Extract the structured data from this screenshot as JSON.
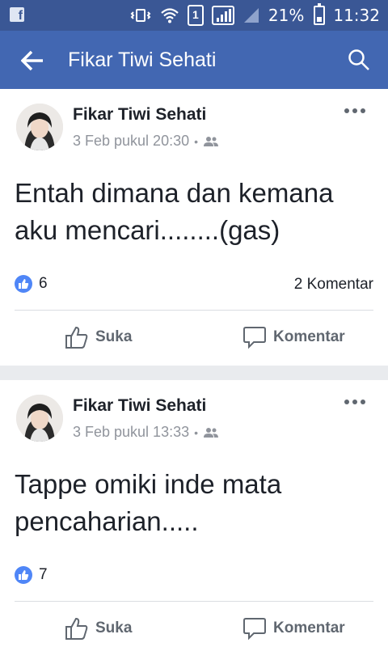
{
  "status_bar": {
    "battery_percent": "21%",
    "time": "11:32",
    "sim": "1"
  },
  "app_bar": {
    "title": "Fikar Tiwi Sehati"
  },
  "posts": [
    {
      "author": "Fikar Tiwi Sehati",
      "timestamp": "3 Feb pukul 20:30",
      "text": "Entah dimana dan kemana aku mencari........(gas)",
      "likes": "6",
      "comments": "2 Komentar",
      "like_label": "Suka",
      "comment_label": "Komentar"
    },
    {
      "author": "Fikar Tiwi Sehati",
      "timestamp": "3 Feb pukul 13:33",
      "text": "Tappe omiki inde mata pencaharian.....",
      "likes": "7",
      "comments": "",
      "like_label": "Suka",
      "comment_label": "Komentar"
    }
  ],
  "colors": {
    "status_bar": "#3a5795",
    "app_bar": "#4267b2",
    "like_badge": "#4f86f7",
    "feed_bg": "#e9ebee"
  }
}
